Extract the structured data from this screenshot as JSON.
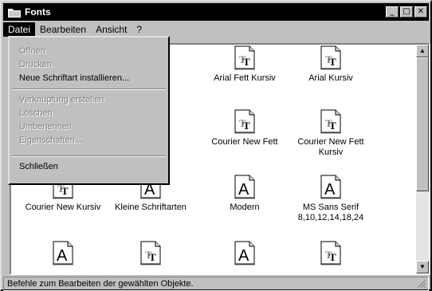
{
  "window": {
    "title": "Fonts",
    "min_label": "_",
    "max_label": "□",
    "close_label": "✕"
  },
  "menubar": {
    "items": [
      "Datei",
      "Bearbeiten",
      "Ansicht",
      "?"
    ]
  },
  "datei_menu": {
    "items": [
      {
        "label": "Öffnen",
        "enabled": false
      },
      {
        "label": "Drucken",
        "enabled": false
      },
      {
        "label": "Neue Schriftart installieren...",
        "enabled": true
      },
      {
        "label": "Verknüpfung erstellen",
        "enabled": false
      },
      {
        "label": "Löschen",
        "enabled": false
      },
      {
        "label": "Umbenennen",
        "enabled": false
      },
      {
        "label": "Eigenschaften...",
        "enabled": false
      },
      {
        "label": "Schließen",
        "enabled": true
      }
    ]
  },
  "fonts": [
    {
      "name": "Arial Fett Kursiv",
      "icon": "truetype-font-icon"
    },
    {
      "name": "Arial Kursiv",
      "icon": "truetype-font-icon"
    },
    {
      "name": "Courier New Fett",
      "icon": "truetype-font-icon"
    },
    {
      "name": "Courier New Fett Kursiv",
      "icon": "truetype-font-icon"
    },
    {
      "name": "Courier New Kursiv",
      "icon": "truetype-font-icon"
    },
    {
      "name": "Kleine Schriftarten",
      "icon": "raster-font-icon"
    },
    {
      "name": "Modern",
      "icon": "raster-font-icon"
    },
    {
      "name": "MS Sans Serif 8,10,12,14,18,24",
      "icon": "raster-font-icon"
    },
    {
      "name": "",
      "icon": "raster-font-icon"
    },
    {
      "name": "",
      "icon": "truetype-font-icon"
    },
    {
      "name": "",
      "icon": "raster-font-icon"
    },
    {
      "name": "",
      "icon": "truetype-font-icon"
    }
  ],
  "status": {
    "text": "Befehle zum Bearbeiten der gewählten Objekte."
  },
  "colors": {
    "titlebar": "#000000",
    "face": "#c0c0c0",
    "client": "#ffffff"
  }
}
